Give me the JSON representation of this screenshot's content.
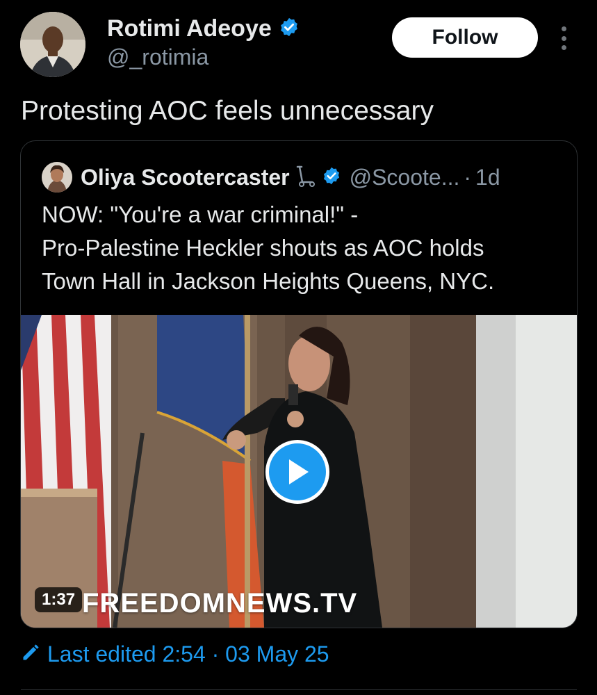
{
  "author": {
    "name": "Rotimi Adeoye",
    "handle": "@_rotimia",
    "verified": true,
    "verified_color": "#1d9bf0"
  },
  "actions": {
    "follow_label": "Follow",
    "more_icon": "more-vertical-icon"
  },
  "tweet": {
    "text": "Protesting AOC feels unnecessary"
  },
  "quoted": {
    "name": "Oliya Scootercaster",
    "scooter_icon": "scooter-icon",
    "handle": "@Scoote...",
    "separator": "·",
    "time": "1d",
    "text_lines": [
      "NOW: \"You're a war criminal!\" -",
      "Pro-Palestine Heckler shouts as AOC holds",
      "Town Hall in Jackson Heights Queens, NYC."
    ],
    "media": {
      "duration": "1:37",
      "watermark": "FREEDOMNEWS.TV",
      "play_icon": "play-icon"
    }
  },
  "edited": {
    "icon": "edit-pencil-icon",
    "text": "Last edited 2:54 · 03 May 25",
    "color": "#1d9bf0"
  }
}
